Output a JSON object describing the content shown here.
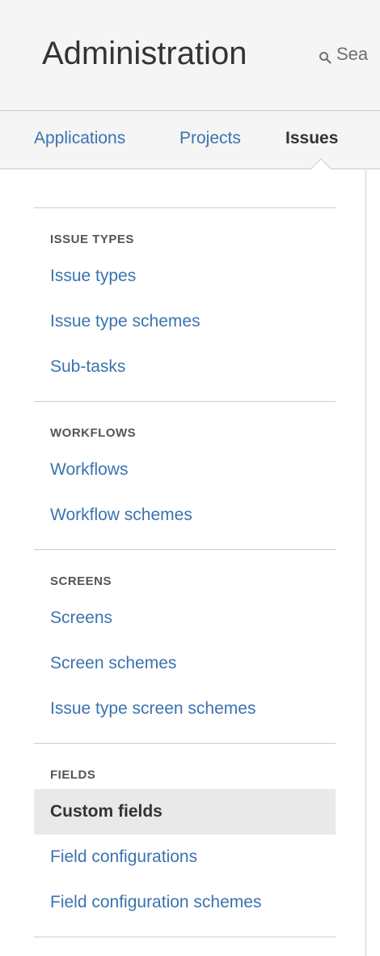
{
  "header": {
    "title": "Administration",
    "search_placeholder": "Sea"
  },
  "tabs": [
    {
      "label": "Applications",
      "active": false
    },
    {
      "label": "Projects",
      "active": false
    },
    {
      "label": "Issues",
      "active": true
    }
  ],
  "sidebar": {
    "sections": [
      {
        "heading": "ISSUE TYPES",
        "items": [
          {
            "label": "Issue types"
          },
          {
            "label": "Issue type schemes"
          },
          {
            "label": "Sub-tasks"
          }
        ]
      },
      {
        "heading": "WORKFLOWS",
        "items": [
          {
            "label": "Workflows"
          },
          {
            "label": "Workflow schemes"
          }
        ]
      },
      {
        "heading": "SCREENS",
        "items": [
          {
            "label": "Screens"
          },
          {
            "label": "Screen schemes"
          },
          {
            "label": "Issue type screen schemes"
          }
        ]
      },
      {
        "heading": "FIELDS",
        "items": [
          {
            "label": "Custom fields",
            "selected": true
          },
          {
            "label": "Field configurations"
          },
          {
            "label": "Field configuration schemes"
          }
        ]
      }
    ]
  },
  "colors": {
    "link": "#3b73af",
    "text": "#333333",
    "header_bg": "#f5f5f5",
    "selected_bg": "#e9e9e9",
    "border": "#cccccc"
  },
  "icons": {
    "search": "search-icon"
  }
}
